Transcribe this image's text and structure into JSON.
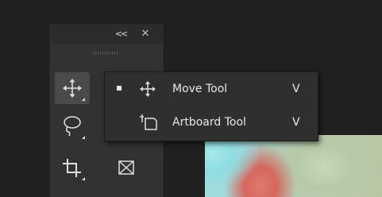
{
  "toolbar": {
    "collapse_icon": "double-chevron-left-icon",
    "close_icon": "close-icon",
    "tools": [
      {
        "name": "move-tool",
        "icon": "move-icon",
        "active": true
      },
      {
        "name": "lasso-tool",
        "icon": "lasso-icon",
        "active": false
      },
      {
        "name": "crop-tool",
        "icon": "crop-icon",
        "active": false
      },
      {
        "name": "frame-tool",
        "icon": "frame-icon",
        "active": false
      }
    ]
  },
  "flyout": {
    "items": [
      {
        "label": "Move Tool",
        "shortcut": "V",
        "icon": "move-icon",
        "selected": true
      },
      {
        "label": "Artboard Tool",
        "shortcut": "V",
        "icon": "artboard-icon",
        "selected": false
      }
    ]
  },
  "colors": {
    "panel": "#323232",
    "flyout": "#2f2f2f",
    "text": "#e8e8e8",
    "background": "#202020"
  }
}
